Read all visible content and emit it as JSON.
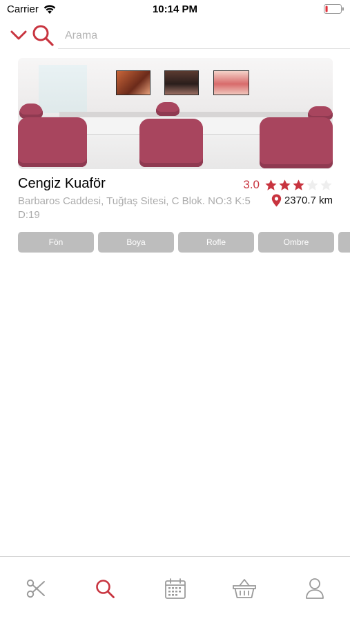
{
  "status_bar": {
    "carrier": "Carrier",
    "time": "10:14 PM",
    "battery_level_percent": 15
  },
  "search": {
    "placeholder": "Arama",
    "value": ""
  },
  "salon": {
    "name": "Cengiz Kuaför",
    "rating": "3.0",
    "rating_value": 3,
    "rating_max": 5,
    "address": "Barbaros Caddesi, Tuğtaş Sitesi, C Blok. NO:3 K:5 D:19",
    "distance": "2370.7 km",
    "services": [
      "Fön",
      "Boya",
      "Rofle",
      "Ombre",
      ""
    ]
  },
  "tab_bar": {
    "tabs": [
      {
        "icon": "scissors-icon",
        "active": false
      },
      {
        "icon": "search-icon",
        "active": true
      },
      {
        "icon": "calendar-icon",
        "active": false
      },
      {
        "icon": "basket-icon",
        "active": false
      },
      {
        "icon": "profile-icon",
        "active": false
      }
    ]
  },
  "colors": {
    "accent": "#c8343f",
    "inactive_icon": "#9a9a9a",
    "tag_background": "#bdbdbd",
    "chair": "#a8455e"
  }
}
